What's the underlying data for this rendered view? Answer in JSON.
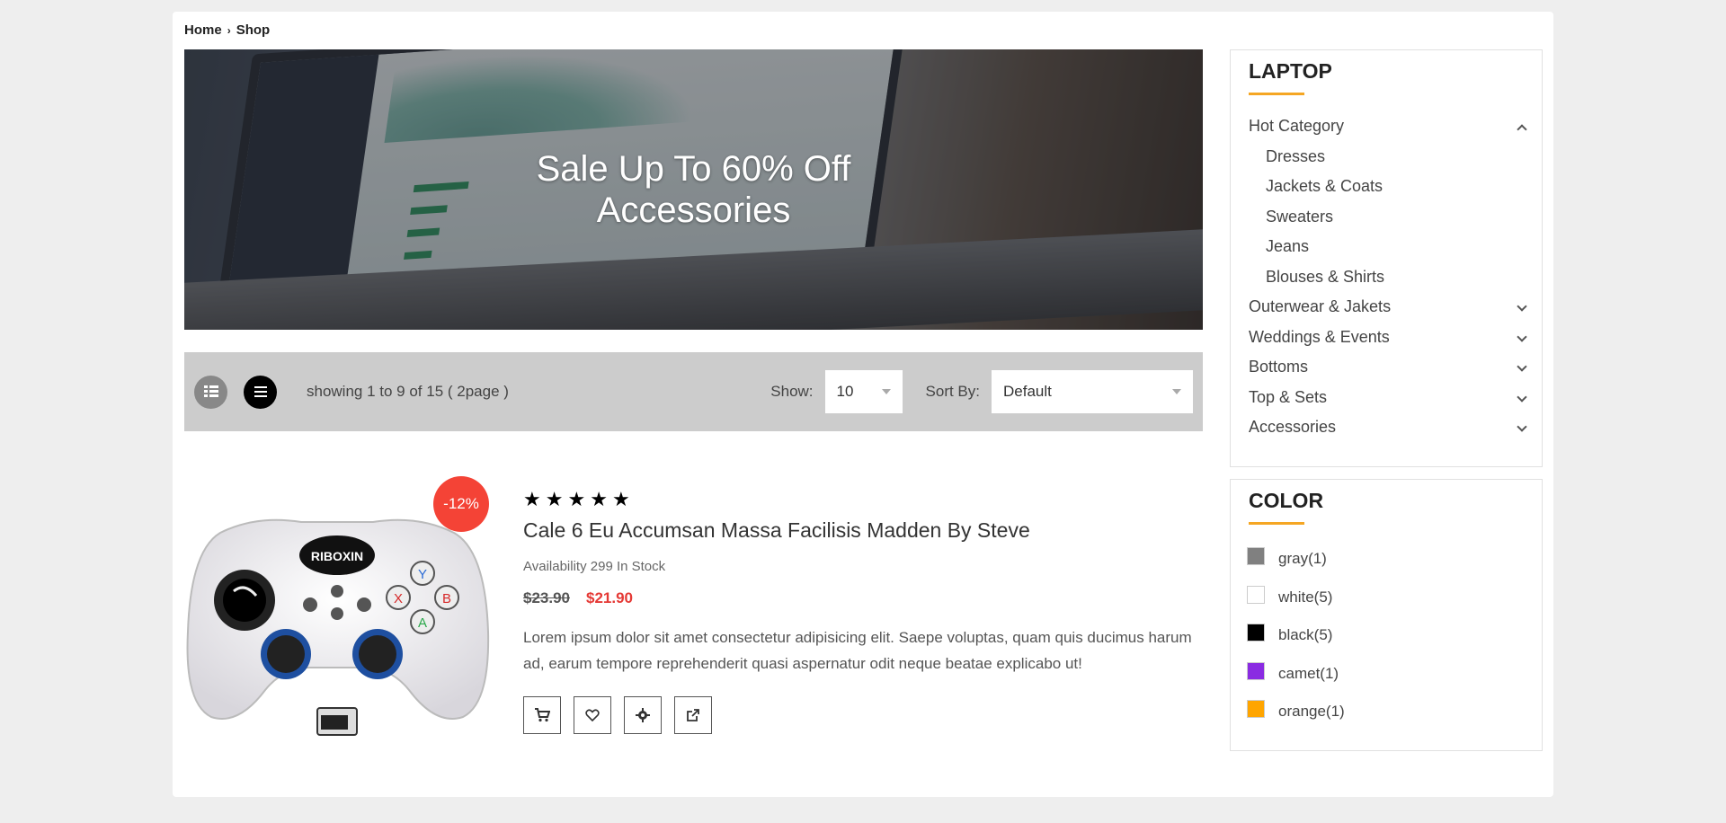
{
  "breadcrumb": {
    "home": "Home",
    "separator": "›",
    "current": "Shop"
  },
  "banner": {
    "line1": "Sale Up To 60% Off",
    "line2": "Accessories"
  },
  "toolbar": {
    "showing": "showing 1 to 9 of 15 ( 2page )",
    "show_label": "Show:",
    "show_value": "10",
    "sort_label": "Sort By:",
    "sort_value": "Default"
  },
  "product": {
    "discount": "-12%",
    "rating": 5,
    "title": "Cale 6 Eu Accumsan Massa Facilisis Madden By Steve",
    "availability": "Availability 299 In Stock",
    "old_price": "$23.90",
    "new_price": "$21.90",
    "description": "Lorem ipsum dolor sit amet consectetur adipisicing elit. Saepe voluptas, quam quis ducimus harum ad, earum tempore reprehenderit quasi aspernatur odit neque beatae explicabo ut!",
    "image_label": "RIBOXIN",
    "actions": [
      "cart-icon",
      "heart-icon",
      "gear-icon",
      "external-link-icon"
    ]
  },
  "sidebar": {
    "laptop_title": "LAPTOP",
    "categories": [
      {
        "label": "Hot Category",
        "expanded": true
      },
      {
        "label": "Dresses",
        "sub": true
      },
      {
        "label": "Jackets & Coats",
        "sub": true
      },
      {
        "label": "Sweaters",
        "sub": true
      },
      {
        "label": "Jeans",
        "sub": true
      },
      {
        "label": "Blouses & Shirts",
        "sub": true
      },
      {
        "label": "Outerwear & Jakets"
      },
      {
        "label": "Weddings & Events"
      },
      {
        "label": "Bottoms"
      },
      {
        "label": "Top & Sets"
      },
      {
        "label": "Accessories"
      }
    ],
    "color_title": "COLOR",
    "colors": [
      {
        "label": "gray(1)",
        "hex": "#808080"
      },
      {
        "label": "white(5)",
        "hex": "#ffffff"
      },
      {
        "label": "black(5)",
        "hex": "#000000"
      },
      {
        "label": "camet(1)",
        "hex": "#8a2be2"
      },
      {
        "label": "orange(1)",
        "hex": "#ffa500"
      }
    ]
  },
  "colors": {
    "accent": "#f5a623",
    "sale": "#f44336",
    "price": "#e53935"
  }
}
